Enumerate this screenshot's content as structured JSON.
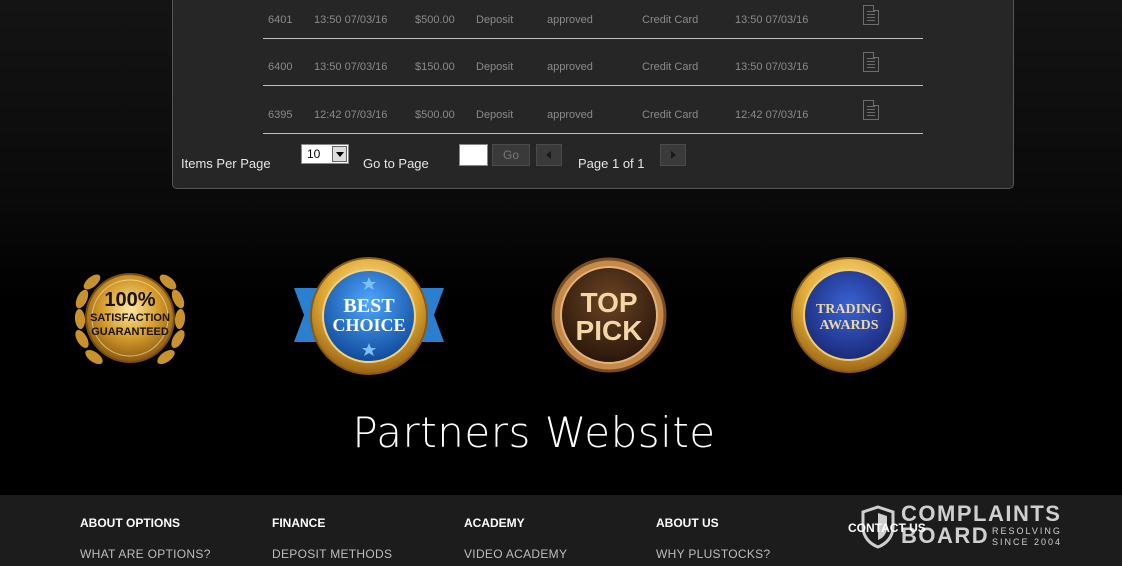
{
  "transactions": {
    "rows": [
      {
        "id": "6401",
        "time": "13:50 07/03/16",
        "amount": "$500.00",
        "type": "Deposit",
        "status": "approved",
        "method": "Credit Card",
        "date": "13:50 07/03/16"
      },
      {
        "id": "6400",
        "time": "13:50 07/03/16",
        "amount": "$150.00",
        "type": "Deposit",
        "status": "approved",
        "method": "Credit Card",
        "date": "13:50 07/03/16"
      },
      {
        "id": "6395",
        "time": "12:42 07/03/16",
        "amount": "$500.00",
        "type": "Deposit",
        "status": "approved",
        "method": "Credit Card",
        "date": "12:42 07/03/16"
      }
    ],
    "document_icon": "document-icon"
  },
  "pagination": {
    "items_per_page_label": "Items Per Page",
    "items_per_page_value": "10",
    "go_to_page_label": "Go to Page",
    "go_to_page_value": "",
    "go_button": "Go",
    "page_info": "Page 1 of 1",
    "prev_icon": "triangle-left-icon",
    "next_icon": "triangle-right-icon"
  },
  "badges": {
    "satisfaction_line1": "100%",
    "satisfaction_line2": "SATISFACTION",
    "satisfaction_line3": "GUARANTEED",
    "best_line1": "BEST",
    "best_line2": "CHOICE",
    "top_line1": "TOP",
    "top_line2": "PICK",
    "trading_line1": "TRADING",
    "trading_line2": "AWARDS"
  },
  "partners_title": "Partners Website",
  "footer": {
    "columns": [
      {
        "heading": "ABOUT OPTIONS",
        "link": "WHAT ARE OPTIONS?"
      },
      {
        "heading": "FINANCE",
        "link": "DEPOSIT METHODS"
      },
      {
        "heading": "ACADEMY",
        "link": "VIDEO ACADEMY"
      },
      {
        "heading": "ABOUT US",
        "link": "WHY PLUSTOCKS?"
      }
    ],
    "contact_us": "CONTACT US"
  },
  "watermark": {
    "line1": "COMPLAINTS",
    "line2": "BOARD",
    "tagline1": "RESOLVING",
    "tagline2": "SINCE 2004"
  },
  "colors": {
    "page_bg": "#000000",
    "panel_bg": "#262626",
    "footer_bg": "#1c1c1c",
    "gold": "#d4a437",
    "blue_badge": "#2a7fd1"
  }
}
